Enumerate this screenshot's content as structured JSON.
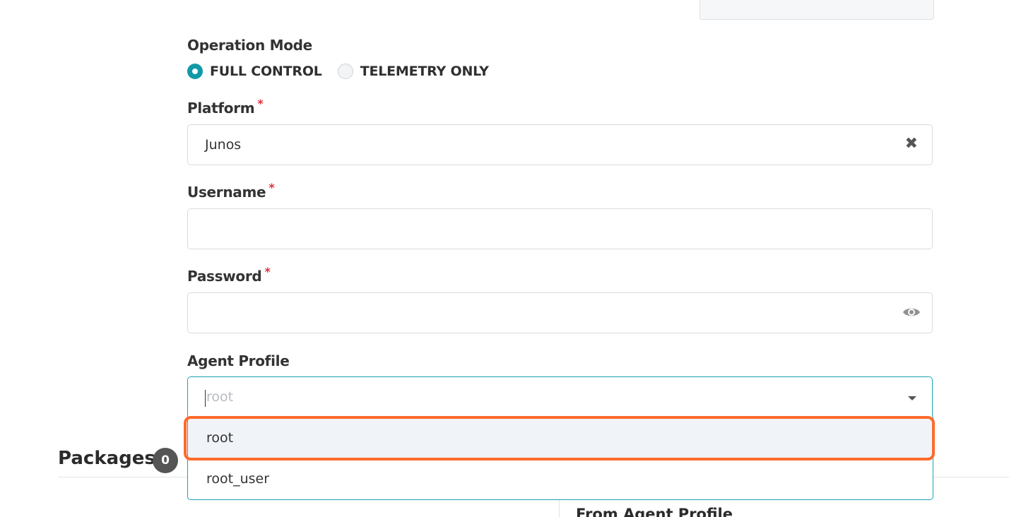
{
  "operation_mode": {
    "label": "Operation Mode",
    "options": [
      {
        "label": "FULL CONTROL",
        "selected": true
      },
      {
        "label": "TELEMETRY ONLY",
        "selected": false
      }
    ]
  },
  "platform": {
    "label": "Platform",
    "required_marker": "*",
    "value": "Junos",
    "clear_icon": "✖"
  },
  "username": {
    "label": "Username",
    "required_marker": "*",
    "value": ""
  },
  "password": {
    "label": "Password",
    "required_marker": "*",
    "value": "",
    "toggle_icon": "eye-icon"
  },
  "agent_profile": {
    "label": "Agent Profile",
    "placeholder": "root",
    "options": [
      "root",
      "root_user"
    ],
    "highlighted_option": "root"
  },
  "packages": {
    "title": "Packages",
    "count": "0",
    "sub_heading": "From Agent Profile"
  },
  "colors": {
    "accent": "#0f9aa8",
    "focus_border": "#1aa3b3",
    "required": "#e0303a",
    "annotation": "#ff6a2c"
  }
}
